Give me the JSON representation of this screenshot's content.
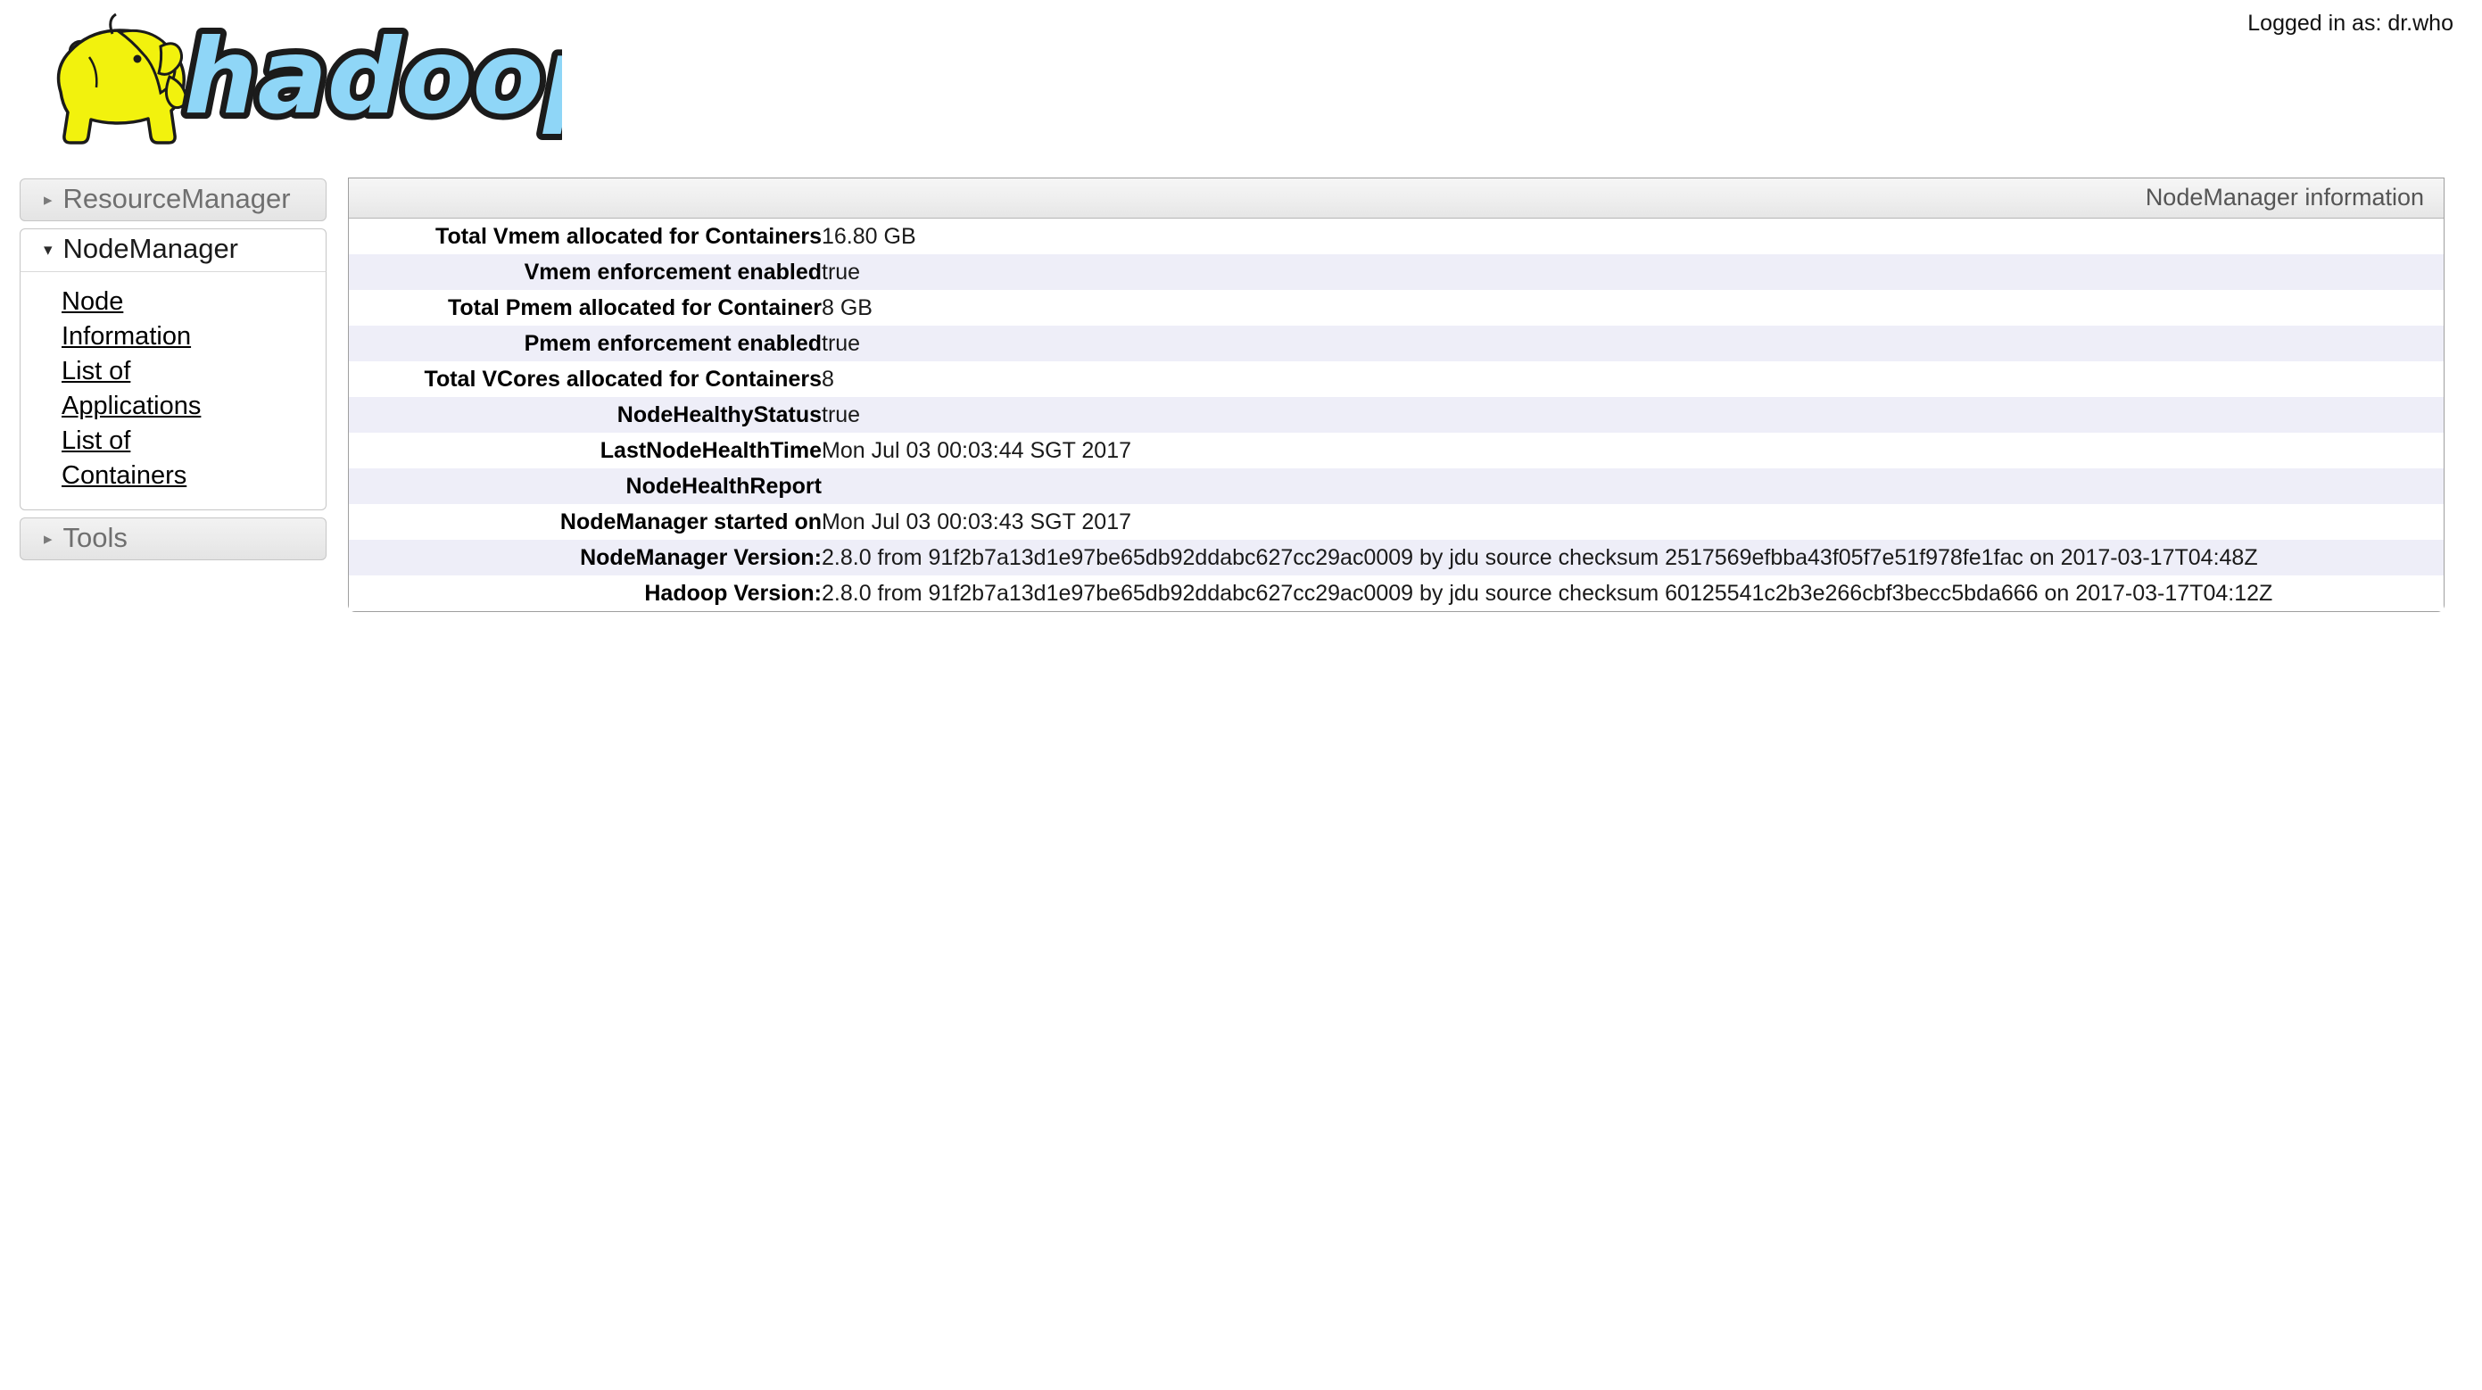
{
  "header": {
    "logo_alt": "hadoop",
    "user_label": "Logged in as: dr.who"
  },
  "sidebar": {
    "sections": [
      {
        "label": "ResourceManager",
        "expanded": false,
        "arrow": "▸",
        "links": []
      },
      {
        "label": "NodeManager",
        "expanded": true,
        "arrow": "▾",
        "links": [
          "Node Information",
          "List of Applications",
          "List of Containers"
        ]
      },
      {
        "label": "Tools",
        "expanded": false,
        "arrow": "▸",
        "links": []
      }
    ]
  },
  "content": {
    "panel_title": "NodeManager information",
    "rows": [
      {
        "key": "Total Vmem allocated for Containers",
        "value": "16.80 GB"
      },
      {
        "key": "Vmem enforcement enabled",
        "value": "true"
      },
      {
        "key": "Total Pmem allocated for Container",
        "value": "8 GB"
      },
      {
        "key": "Pmem enforcement enabled",
        "value": "true"
      },
      {
        "key": "Total VCores allocated for Containers",
        "value": "8"
      },
      {
        "key": "NodeHealthyStatus",
        "value": "true"
      },
      {
        "key": "LastNodeHealthTime",
        "value": "Mon Jul 03 00:03:44 SGT 2017"
      },
      {
        "key": "NodeHealthReport",
        "value": ""
      },
      {
        "key": "NodeManager started on",
        "value": "Mon Jul 03 00:03:43 SGT 2017"
      },
      {
        "key": "NodeManager Version:",
        "value": "2.8.0 from 91f2b7a13d1e97be65db92ddabc627cc29ac0009 by jdu source checksum 2517569efbba43f05f7e51f978fe1fac on 2017-03-17T04:48Z"
      },
      {
        "key": "Hadoop Version:",
        "value": "2.8.0 from 91f2b7a13d1e97be65db92ddabc627cc29ac0009 by jdu source checksum 60125541c2b3e266cbf3becc5bda666 on 2017-03-17T04:12Z"
      }
    ]
  },
  "colors": {
    "row_alt": "#eeeef8",
    "panel_border": "#9f9f9f",
    "header_text": "#555555",
    "logo_blue": "#8fd6f7",
    "logo_yellow": "#f2f20d"
  }
}
